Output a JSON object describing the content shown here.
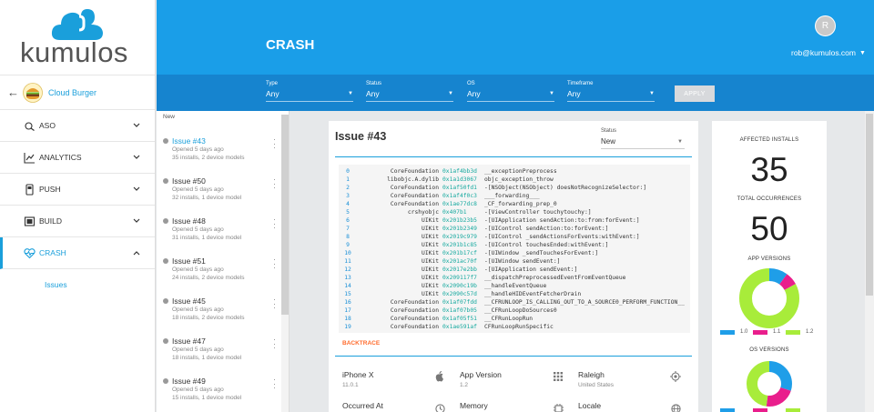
{
  "brand": {
    "name": "kumulos",
    "accent": "#1a9ee8",
    "logo_color": "#1a9fdb"
  },
  "sidebar": {
    "app_name": "Cloud Burger",
    "items": [
      {
        "label": "ASO",
        "icon": "aso-icon",
        "chevron": "⌄"
      },
      {
        "label": "ANALYTICS",
        "icon": "analytics-chart-icon",
        "chevron": "⌄"
      },
      {
        "label": "PUSH",
        "icon": "push-phone-icon",
        "chevron": "⌄"
      },
      {
        "label": "BUILD",
        "icon": "build-stack-icon",
        "chevron": "⌄"
      },
      {
        "label": "CRASH",
        "icon": "crash-heartbeat-icon",
        "chevron": "⌃"
      }
    ],
    "subitem": "Issues"
  },
  "header": {
    "title": "CRASH",
    "avatar_initial": "R",
    "user_email": "rob@kumulos.com"
  },
  "filters": [
    {
      "label": "Type",
      "value": "Any"
    },
    {
      "label": "Status",
      "value": "Any"
    },
    {
      "label": "OS",
      "value": "Any"
    },
    {
      "label": "Timeframe",
      "value": "Any"
    }
  ],
  "apply_label": "APPLY",
  "issues": {
    "section_label": "New",
    "list": [
      {
        "title": "Issue #43",
        "opened": "Opened 5 days ago",
        "meta": "35 installs, 2 device models"
      },
      {
        "title": "Issue #50",
        "opened": "Opened 5 days ago",
        "meta": "32 installs, 1 device model"
      },
      {
        "title": "Issue #48",
        "opened": "Opened 5 days ago",
        "meta": "31 installs, 1 device model"
      },
      {
        "title": "Issue #51",
        "opened": "Opened 5 days ago",
        "meta": "24 installs, 2 device models"
      },
      {
        "title": "Issue #45",
        "opened": "Opened 5 days ago",
        "meta": "18 installs, 2 device models"
      },
      {
        "title": "Issue #47",
        "opened": "Opened 5 days ago",
        "meta": "18 installs, 1 device model"
      },
      {
        "title": "Issue #49",
        "opened": "Opened 5 days ago",
        "meta": "15 installs, 1 device model"
      }
    ]
  },
  "detail": {
    "title": "Issue #43",
    "status_label": "Status",
    "status_value": "New",
    "backtrace_tab": "BACKTRACE",
    "frames": [
      {
        "n": "0",
        "lib": "CoreFoundation",
        "addr": "0x1af4bb3d",
        "sym": "__exceptionPreprocess"
      },
      {
        "n": "1",
        "lib": "libobjc.A.dylib",
        "addr": "0x1a1d3067",
        "sym": "objc_exception_throw"
      },
      {
        "n": "2",
        "lib": "CoreFoundation",
        "addr": "0x1af50fd1",
        "sym": "-[NSObject(NSObject) doesNotRecognizeSelector:]"
      },
      {
        "n": "3",
        "lib": "CoreFoundation",
        "addr": "0x1af4f0c3",
        "sym": "___forwarding___"
      },
      {
        "n": "4",
        "lib": "CoreFoundation",
        "addr": "0x1ae77dc8",
        "sym": "_CF_forwarding_prep_0"
      },
      {
        "n": "5",
        "lib": "crshyobjc",
        "addr": "0x407b1",
        "sym": "-[ViewController touchytouchy:]"
      },
      {
        "n": "6",
        "lib": "UIKit",
        "addr": "0x201b23b5",
        "sym": "-[UIApplication sendAction:to:from:forEvent:]"
      },
      {
        "n": "7",
        "lib": "UIKit",
        "addr": "0x201b2349",
        "sym": "-[UIControl sendAction:to:forEvent:]"
      },
      {
        "n": "8",
        "lib": "UIKit",
        "addr": "0x2019c979",
        "sym": "-[UIControl _sendActionsForEvents:withEvent:]"
      },
      {
        "n": "9",
        "lib": "UIKit",
        "addr": "0x201b1c85",
        "sym": "-[UIControl touchesEnded:withEvent:]"
      },
      {
        "n": "10",
        "lib": "UIKit",
        "addr": "0x201b17cf",
        "sym": "-[UIWindow _sendTouchesForEvent:]"
      },
      {
        "n": "11",
        "lib": "UIKit",
        "addr": "0x201ac70f",
        "sym": "-[UIWindow sendEvent:]"
      },
      {
        "n": "12",
        "lib": "UIKit",
        "addr": "0x2017e2bb",
        "sym": "-[UIApplication sendEvent:]"
      },
      {
        "n": "13",
        "lib": "UIKit",
        "addr": "0x209117f7",
        "sym": "__dispatchPreprocessedEventFromEventQueue"
      },
      {
        "n": "14",
        "lib": "UIKit",
        "addr": "0x2090c19b",
        "sym": "__handleEventQueue"
      },
      {
        "n": "15",
        "lib": "UIKit",
        "addr": "0x2090c57d",
        "sym": "__handleHIDEventFetcherDrain"
      },
      {
        "n": "16",
        "lib": "CoreFoundation",
        "addr": "0x1af07fdd",
        "sym": "__CFRUNLOOP_IS_CALLING_OUT_TO_A_SOURCE0_PERFORM_FUNCTION__"
      },
      {
        "n": "17",
        "lib": "CoreFoundation",
        "addr": "0x1af07b05",
        "sym": "__CFRunLoopDoSources0"
      },
      {
        "n": "18",
        "lib": "CoreFoundation",
        "addr": "0x1af05f51",
        "sym": "__CFRunLoopRun"
      },
      {
        "n": "19",
        "lib": "CoreFoundation",
        "addr": "0x1ae591af",
        "sym": "CFRunLoopRunSpecific"
      }
    ],
    "props": {
      "device": {
        "key": "iPhone X",
        "value": "11.0.1"
      },
      "app_version": {
        "key": "App Version",
        "value": "1.2"
      },
      "location": {
        "key": "Raleigh",
        "value": "United States"
      },
      "occurred_at": {
        "key": "Occurred At"
      },
      "memory": {
        "key": "Memory"
      },
      "locale": {
        "key": "Locale"
      }
    }
  },
  "stats": {
    "affected_installs_label": "AFFECTED INSTALLS",
    "affected_installs": "35",
    "total_occurrences_label": "TOTAL OCCURRENCES",
    "total_occurrences": "50",
    "app_versions_label": "APP VERSIONS",
    "os_versions_label": "OS VERSIONS",
    "app_versions": [
      {
        "label": "1.0",
        "value": 0.1,
        "color": "#1f9ee8"
      },
      {
        "label": "1.1",
        "value": 0.07,
        "color": "#e91e8c"
      },
      {
        "label": "1.2",
        "value": 0.83,
        "color": "#a8ec3a"
      }
    ],
    "os_versions": [
      {
        "value": 0.3,
        "color": "#1f9ee8"
      },
      {
        "value": 0.22,
        "color": "#e91e8c"
      },
      {
        "value": 0.48,
        "color": "#a8ec3a"
      }
    ]
  }
}
